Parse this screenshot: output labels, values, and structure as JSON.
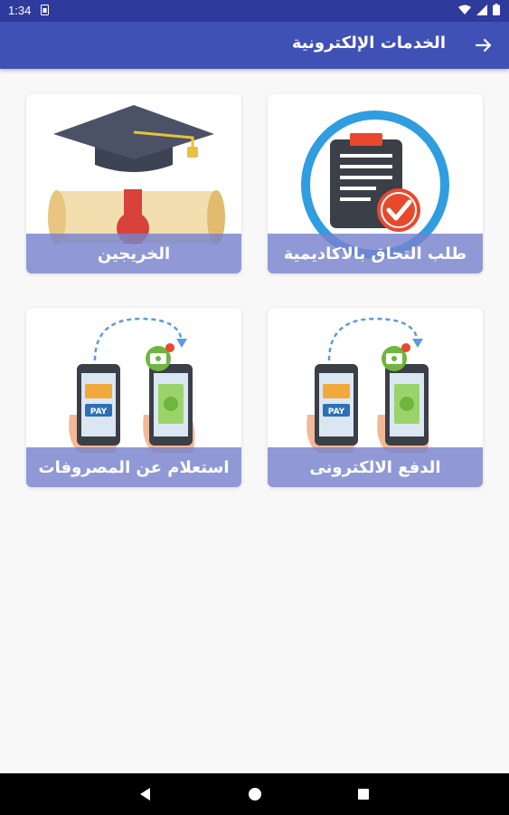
{
  "status_bar": {
    "time": "1:34"
  },
  "app_bar": {
    "title": "الخدمات الإلكترونية",
    "back_icon": "arrow-right-icon"
  },
  "cards": [
    {
      "label": "طلب التحاق بالاكاديمية",
      "icon": "clipboard-check-icon"
    },
    {
      "label": "الخريجين",
      "icon": "graduation-cap-icon"
    },
    {
      "label": "الدفع الالكترونى",
      "icon": "mobile-payment-icon"
    },
    {
      "label": "استعلام عن المصروفات",
      "icon": "mobile-payment-icon"
    }
  ],
  "colors": {
    "primary": "#3f51b5",
    "status_bar": "#2f3a9d",
    "label_overlay": "#7882cd"
  }
}
